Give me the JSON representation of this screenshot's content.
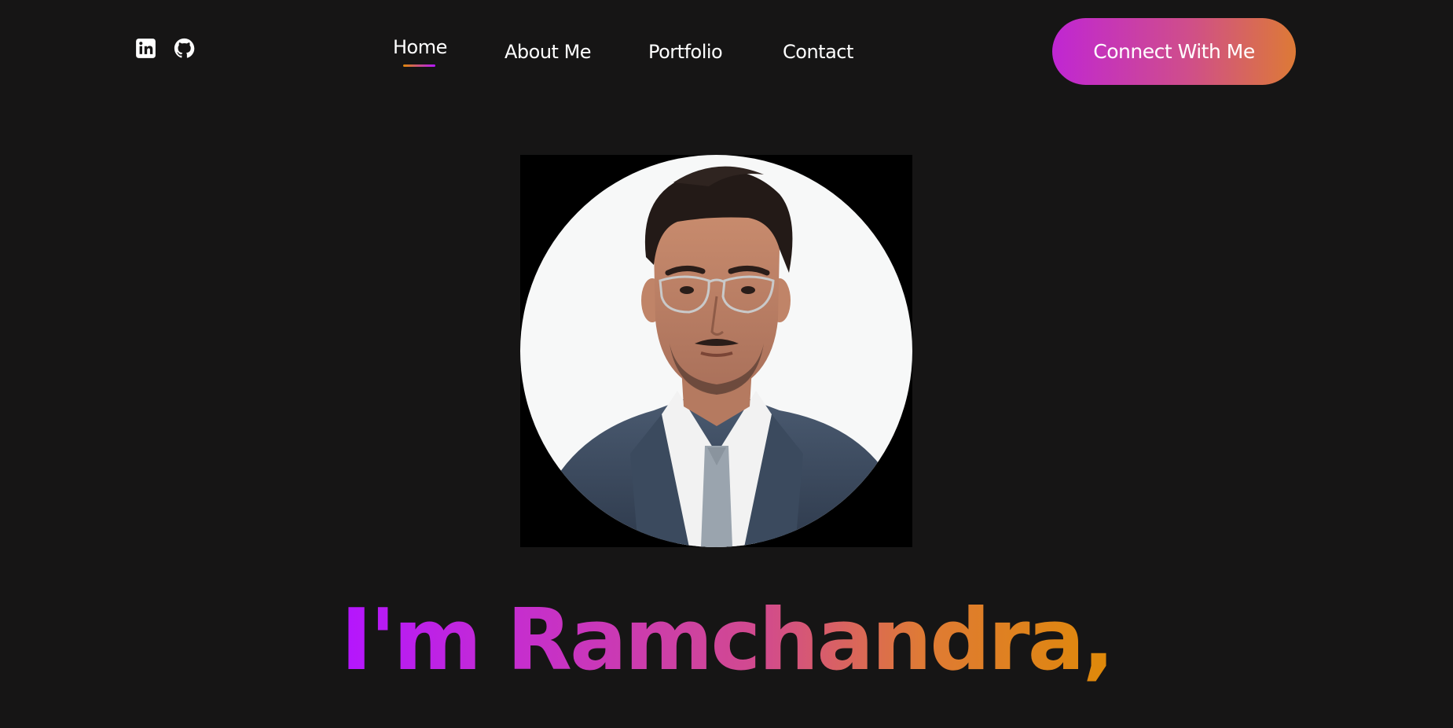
{
  "header": {
    "socials": [
      {
        "icon": "linkedin-icon",
        "label": "LinkedIn"
      },
      {
        "icon": "github-icon",
        "label": "GitHub"
      }
    ],
    "nav": {
      "items": [
        {
          "label": "Home",
          "active": true
        },
        {
          "label": "About Me",
          "active": false
        },
        {
          "label": "Portfolio",
          "active": false
        },
        {
          "label": "Contact",
          "active": false
        }
      ]
    },
    "cta_label": "Connect With Me"
  },
  "hero": {
    "title": "I'm Ramchandra,"
  },
  "colors": {
    "background": "#161515",
    "gradient_start": "#b415ff",
    "gradient_end": "#df8908",
    "text": "#ffffff"
  }
}
